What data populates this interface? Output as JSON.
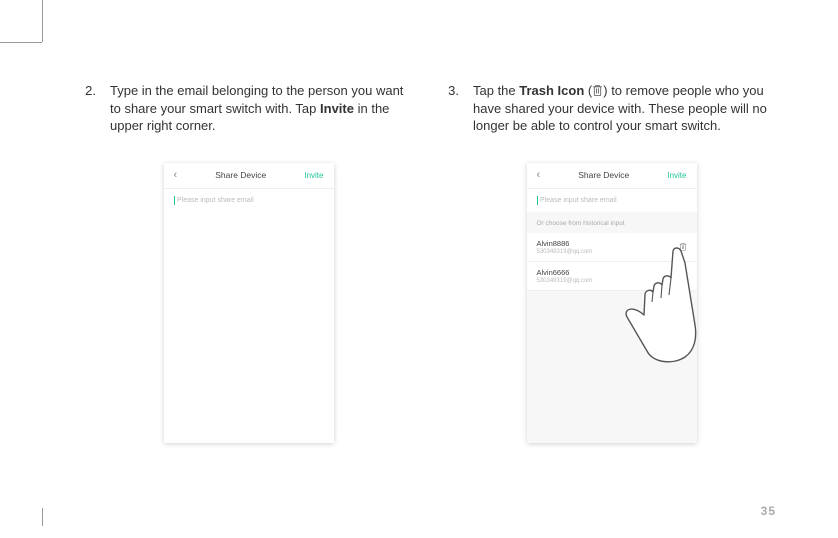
{
  "page_number": "35",
  "step2": {
    "number": "2.",
    "text_before": "Type in the email belonging to the person you want to share your smart switch with. Tap ",
    "bold": "Invite",
    "text_after": " in the upper right corner."
  },
  "step3": {
    "number": "3.",
    "text_before": "Tap the ",
    "bold": "Trash Icon",
    "text_mid": " (",
    "text_after": ") to remove people who you have shared your device with. These people will no longer be able to control your smart switch."
  },
  "phone1": {
    "title": "Share Device",
    "invite": "Invite",
    "placeholder": "Please input share email"
  },
  "phone2": {
    "title": "Share Device",
    "invite": "Invite",
    "placeholder": "Please input share email",
    "choose_label": "Or choose from historical input",
    "contacts": [
      {
        "name": "Alvin8886",
        "email": "530349319@qq.com"
      },
      {
        "name": "Alvin6666",
        "email": "530349319@qq.com"
      }
    ]
  }
}
